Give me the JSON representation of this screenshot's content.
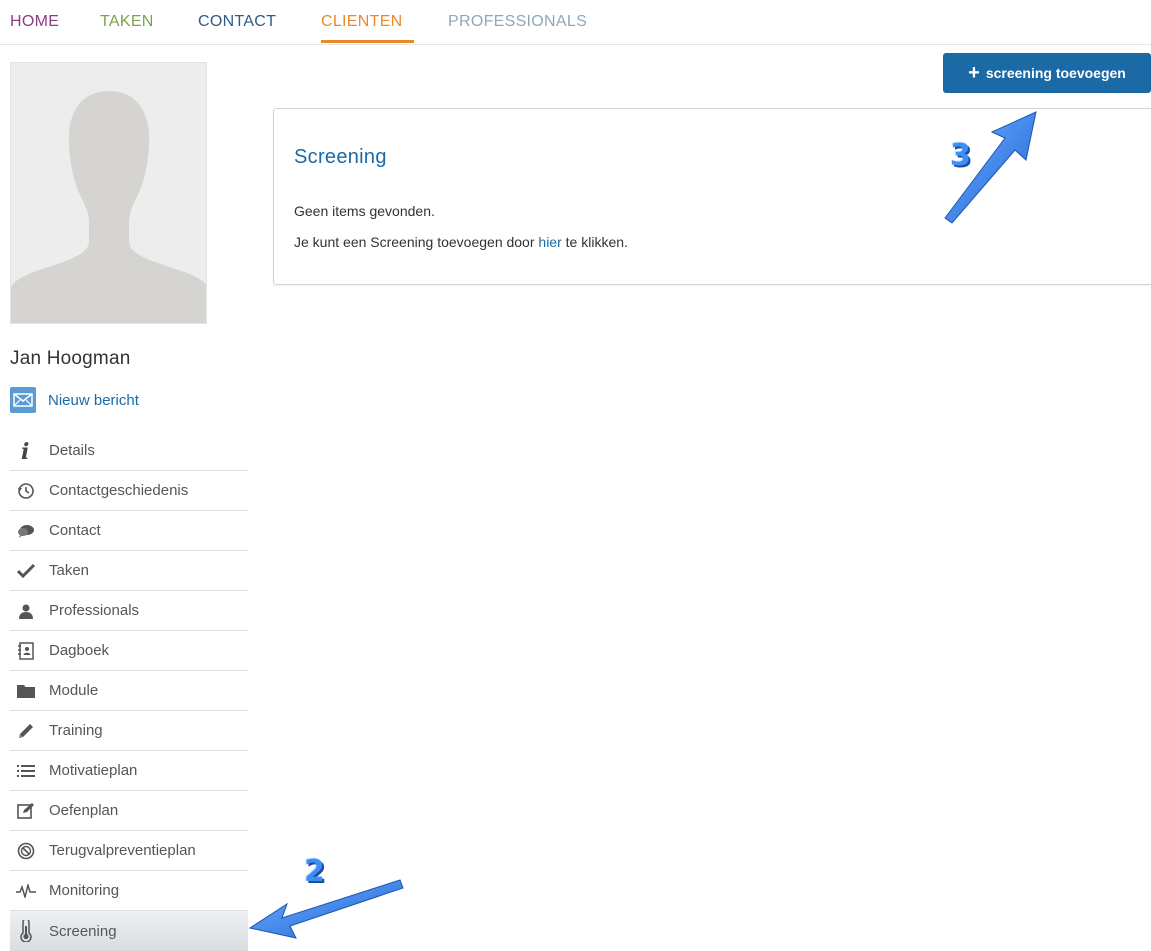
{
  "topnav": {
    "items": [
      {
        "label": "HOME",
        "color": "#8a3e86"
      },
      {
        "label": "TAKEN",
        "color": "#7ea24a"
      },
      {
        "label": "CONTACT",
        "color": "#2f5b87"
      },
      {
        "label": "CLIENTEN",
        "color": "#e98a2a",
        "active": true
      },
      {
        "label": "PROFESSIONALS",
        "color": "#8fa8b8"
      }
    ]
  },
  "client": {
    "name": "Jan Hoogman",
    "new_message": "Nieuw bericht"
  },
  "sidebar": {
    "items": [
      {
        "label": "Details",
        "icon": "info-icon"
      },
      {
        "label": "Contactgeschiedenis",
        "icon": "history-icon"
      },
      {
        "label": "Contact",
        "icon": "chat-icon"
      },
      {
        "label": "Taken",
        "icon": "check-icon"
      },
      {
        "label": "Professionals",
        "icon": "user-icon"
      },
      {
        "label": "Dagboek",
        "icon": "diary-icon"
      },
      {
        "label": "Module",
        "icon": "folder-icon"
      },
      {
        "label": "Training",
        "icon": "pencil-icon"
      },
      {
        "label": "Motivatieplan",
        "icon": "list-icon"
      },
      {
        "label": "Oefenplan",
        "icon": "edit-icon"
      },
      {
        "label": "Terugvalpreventieplan",
        "icon": "ban-icon"
      },
      {
        "label": "Monitoring",
        "icon": "pulse-icon"
      },
      {
        "label": "Screening",
        "icon": "thermometer-icon",
        "selected": true
      }
    ]
  },
  "toolbar": {
    "add_label": "screening toevoegen"
  },
  "panel": {
    "title": "Screening",
    "empty_text": "Geen items gevonden.",
    "hint_before": "Je kunt een Screening toevoegen door ",
    "hint_link": "hier",
    "hint_after": " te klikken."
  },
  "annotations": {
    "step_2": "2",
    "step_3": "3"
  },
  "colors": {
    "accent": "#1b6aa5",
    "link": "#1a6aa8",
    "annotation": "#3e8ef7"
  }
}
